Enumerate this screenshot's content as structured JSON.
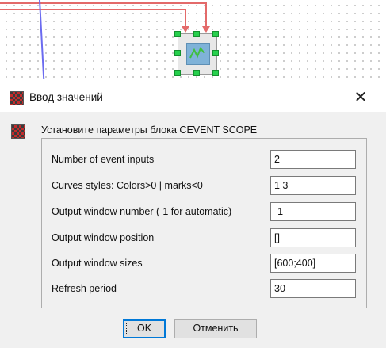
{
  "dialog": {
    "title": "Ввод значений",
    "close_symbol": "✕",
    "header": "Установите параметры блока CEVENT SCOPE",
    "parameters": [
      {
        "label": "Number of event inputs",
        "value": "2"
      },
      {
        "label": "Curves styles: Colors>0 | marks<0",
        "value": "1 3"
      },
      {
        "label": "Output window number (-1 for automatic)",
        "value": "-1"
      },
      {
        "label": "Output window position",
        "value": "[]"
      },
      {
        "label": "Output window sizes",
        "value": "[600;400]"
      },
      {
        "label": "Refresh period",
        "value": "30"
      }
    ],
    "buttons": {
      "ok": "OK",
      "cancel": "Отменить"
    }
  },
  "canvas": {
    "block_icon": "scope-icon",
    "wire_colors": {
      "red": "#e36a6a",
      "blue": "#6b6bf0"
    },
    "handle_color": "#27d04d"
  }
}
